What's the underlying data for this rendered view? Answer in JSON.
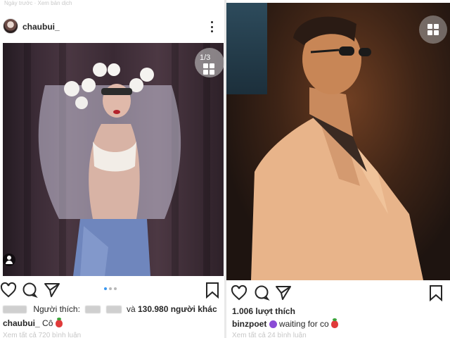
{
  "left_post": {
    "top_strip": "Ngày trước · Xem bản dịch",
    "username": "chaubui_",
    "counter": "1/3",
    "likes_prefix": "Người thích:",
    "likes_and": "và",
    "likes_count": "130.980 người khác",
    "caption_user": "chaubui_",
    "caption_text": "Cô",
    "cut_text": "Xem tất cả 720 bình luận"
  },
  "right_post": {
    "likes": "1.006 lượt thích",
    "caption_user": "binzpoet",
    "caption_text": "waiting for co",
    "cut_text": "Xem tất cả 24 bình luận"
  },
  "icons": {
    "left": [
      "heart-icon",
      "comment-icon",
      "share-icon",
      "bookmark-icon",
      "more-icon",
      "grid-icon",
      "user-tag-icon"
    ],
    "right": [
      "heart-icon",
      "comment-icon",
      "share-icon",
      "bookmark-icon",
      "grid-icon"
    ]
  },
  "colors": {
    "text": "#262626",
    "dot_active": "#3897f0",
    "strawberry": "#e03a3a",
    "devil_emoji": "#8a4bd6"
  }
}
